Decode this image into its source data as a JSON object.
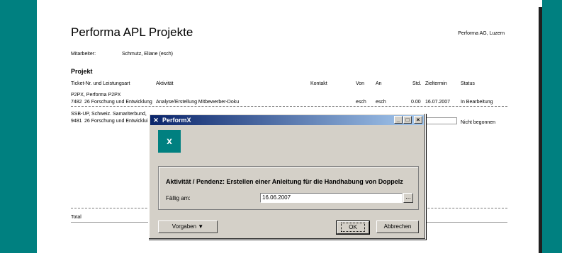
{
  "report": {
    "title": "Performa APL Projekte",
    "company": "Performa AG, Luzern",
    "employee_label": "Mitarbeiter:",
    "employee_value": "Schmutz, Eliane (esch)",
    "section": "Projekt",
    "columns": [
      "Ticket-Nr. und Leistungsart",
      "Aktivität",
      "Kontakt",
      "Von",
      "An",
      "Std.",
      "Zieltermin",
      "Status"
    ],
    "groups": [
      {
        "name": "P2PX, Performa P2PX",
        "ticket": "7482",
        "code": "26 Forschung und Entwicklung",
        "activity": "Analyse/Erstellung Mitbewerber-Doku",
        "von": "esch",
        "an": "esch",
        "std": "0.00",
        "date": "16.07.2007",
        "status": "In Bearbeitung"
      },
      {
        "name": "SSB-UP, Schweiz. Samariterbund,",
        "ticket": "9481",
        "code": "26 Forschung und Entwicklui",
        "status": "Nicht begonnen"
      }
    ],
    "total_label": "Total"
  },
  "dialog": {
    "title": "PerformX",
    "logo_glyph": "x",
    "min": "_",
    "max": "□",
    "close": "×",
    "activity_text": "Aktivität / Pendenz: Erstellen einer Anleitung für die Handhabung von Doppelz",
    "due_label": "Fällig am:",
    "due_value": "16.06.2007",
    "ellipsis": "...",
    "vorgaben_label": "Vorgaben",
    "vorgaben_arrow": "▼",
    "ok_label": "OK",
    "cancel_label": "Abbrechen"
  }
}
